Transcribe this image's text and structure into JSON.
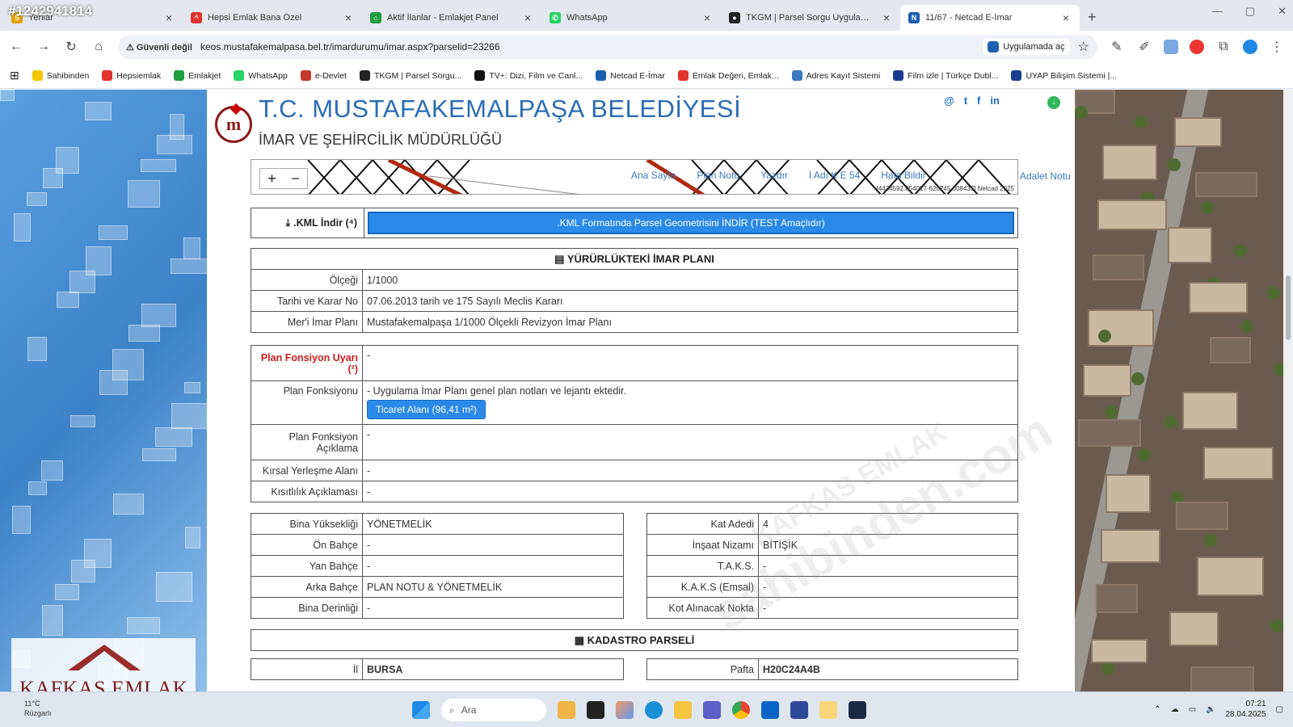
{
  "overlay_id": "#1242941814",
  "tabs": [
    {
      "title": "Yerllar",
      "color": "#e6a100",
      "glyph": "S",
      "active": false
    },
    {
      "title": "Hepsi Emlak Bana Özel",
      "color": "#e2322d",
      "glyph": "^",
      "active": false
    },
    {
      "title": "Aktif İlanlar - Emlakjet Panel",
      "color": "#1f9e3f",
      "glyph": "⌂",
      "active": false
    },
    {
      "title": "WhatsApp",
      "color": "#25d366",
      "glyph": "✆",
      "active": false
    },
    {
      "title": "TKGM | Parsel Sorgu Uygulaması",
      "color": "#222222",
      "glyph": "●",
      "active": false
    },
    {
      "title": "11/67 - Netcad E-İmar",
      "color": "#1b5fb0",
      "glyph": "N",
      "active": true
    }
  ],
  "address": {
    "security": "Güvenli değil",
    "url": "keos.mustafakemalpasa.bel.tr/imardurumu/imar.aspx?parselid=23266",
    "open_in_app": "Uygulamada aç"
  },
  "bookmarks": [
    {
      "label": "Sahibinden",
      "color": "#f5c400"
    },
    {
      "label": "Hepsiemlak",
      "color": "#e2322d"
    },
    {
      "label": "Emlakjet",
      "color": "#1f9e3f"
    },
    {
      "label": "WhatsApp",
      "color": "#25d366"
    },
    {
      "label": "e-Devlet",
      "color": "#c0392b"
    },
    {
      "label": "TKGM | Parsel Sorgu...",
      "color": "#222222"
    },
    {
      "label": "TV+: Dizi, Film ve Canl...",
      "color": "#111111"
    },
    {
      "label": "Netcad E-İmar",
      "color": "#1b5fb0"
    },
    {
      "label": "Emlak Değeri, Emlak...",
      "color": "#e2322d"
    },
    {
      "label": "Adres Kayıt Sistemi",
      "color": "#3a78c0"
    },
    {
      "label": "Film izle | Türkçe Dubl...",
      "color": "#1b3d8f"
    },
    {
      "label": "UYAP Bilişim Sistemi |...",
      "color": "#1b3d8f"
    }
  ],
  "header": {
    "title": "T.C. MUSTAFAKEMALPAŞA BELEDİYESİ",
    "subtitle": "İMAR VE ŞEHİRCİLİK MÜDÜRLÜĞÜ",
    "logo_text": "m",
    "social": [
      "@",
      "t",
      "f",
      "in"
    ]
  },
  "map": {
    "zoom_in": "+",
    "zoom_out": "−",
    "links": [
      "Ana Sayfa",
      "Plan Notu",
      "Yazdır",
      "İ Adı K E 54",
      "Hata Bildir"
    ],
    "extra_link": "Adalet Notu",
    "coord": "[4434592.054017-620245.008433] Netcad 2025"
  },
  "kml": {
    "label": ".KML İndir (⁴)",
    "button": ".KML Formatında Parsel Geometrisini İNDİR (TEST Amaçlıdır)"
  },
  "plan": {
    "section_title": "YÜRÜRLÜKTEKİ İMAR PLANI",
    "rows": [
      {
        "label": "Ölçeği",
        "value": "1/1000"
      },
      {
        "label": "Tarihi ve Karar No",
        "value": "07.06.2013 tarih ve 175 Sayılı Meclis Kararı"
      },
      {
        "label": "Mer'i İmar Planı",
        "value": "Mustafakemalpaşa 1/1000 Ölçekli Revizyon İmar Planı"
      }
    ]
  },
  "function": {
    "warn_label": "Plan Fonsiyon Uyarı (²)",
    "warn_value": "-",
    "func_label": "Plan Fonksiyonu",
    "func_note": "- Uygulama İmar Planı genel plan notları ve lejantı ektedir.",
    "func_button": "Ticaret Alanı (96,41 m²)",
    "desc_label": "Plan Fonksiyon Açıklama",
    "desc_value": "-",
    "rural_label": "Kırsal Yerleşme Alanı",
    "rural_value": "-",
    "restrict_label": "Kısıtlılık Açıklaması",
    "restrict_value": "-"
  },
  "building_left": [
    {
      "label": "Bina Yüksekliği",
      "value": "YÖNETMELİK"
    },
    {
      "label": "Ön Bahçe",
      "value": "-"
    },
    {
      "label": "Yan Bahçe",
      "value": "-"
    },
    {
      "label": "Arka Bahçe",
      "value": "PLAN NOTU & YÖNETMELİK"
    },
    {
      "label": "Bina Derinliği",
      "value": "-"
    }
  ],
  "building_right": [
    {
      "label": "Kat Adedi",
      "value": "4"
    },
    {
      "label": "İnşaat Nizamı",
      "value": "BİTİŞİK"
    },
    {
      "label": "T.A.K.S.",
      "value": "-"
    },
    {
      "label": "K.A.K.S (Emsal)",
      "value": "-"
    },
    {
      "label": "Kot Alınacak Nokta",
      "value": "-"
    }
  ],
  "cadastre": {
    "section_title": "KADASTRO PARSELİ",
    "left": {
      "label": "İl",
      "value": "BURSA"
    },
    "right": {
      "label": "Pafta",
      "value": "H20C24A4B"
    }
  },
  "watermark": {
    "line1": "sahibinden.com",
    "line2": "KAFKAS EMLAK"
  },
  "brand": {
    "name": "KAFKAS EMLAK"
  },
  "taskbar": {
    "weather_temp": "11°C",
    "weather_desc": "Rüzgarlı",
    "search": "Ara",
    "time": "07:21",
    "date": "28.04.2025"
  }
}
